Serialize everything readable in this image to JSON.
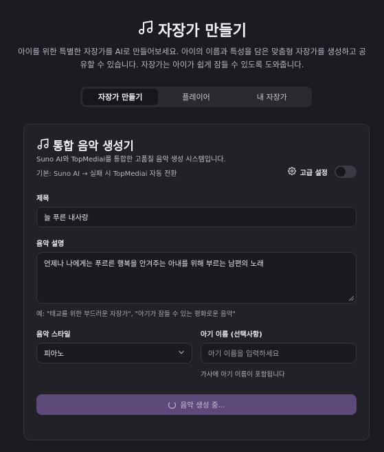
{
  "header": {
    "title": "자장가 만들기",
    "subtitle": "아이를 위한 특별한 자장가를 AI로 만들어보세요. 아이의 이름과 특성을 담은 맞춤형 자장가를 생성하고 공유할 수 있습니다. 자장가는 아이가 쉽게 잠들 수 있도록 도와줍니다.",
    "icon": "music-note-icon"
  },
  "tabs": [
    {
      "label": "자장가 만들기",
      "active": true
    },
    {
      "label": "플레이어",
      "active": false
    },
    {
      "label": "내 자장가",
      "active": false
    }
  ],
  "card": {
    "title": "통합 음악 생성기",
    "description": "Suno AI와 TopMediai를 통합한 고품질 음악 생성 시스템입니다.",
    "default_note": "기본: Suno AI → 실패 시 TopMediai 자동 전환",
    "advanced_label": "고급 설정",
    "advanced_enabled": false
  },
  "form": {
    "title_label": "제목",
    "title_value": "늘 푸른 내사랑",
    "desc_label": "음악 설명",
    "desc_value": "언제나 나에게는 푸르른 행복을 안겨주는 아내를 위해 부르는 남편의 노래",
    "desc_hint": "예: \"태교를 위한 부드러운 자장가\", \"아기가 잠들 수 있는 평화로운 음악\"",
    "style_label": "음악 스타일",
    "style_value": "피아노",
    "baby_label": "아기 이름 (선택사항)",
    "baby_placeholder": "아기 이름을 입력하세요",
    "baby_note": "가사에 아기 이름이 포함됩니다",
    "generate_label": "음악 생성 중..."
  },
  "colors": {
    "background": "#1b1b21",
    "card": "#212127",
    "button": "#5e4a7a"
  }
}
